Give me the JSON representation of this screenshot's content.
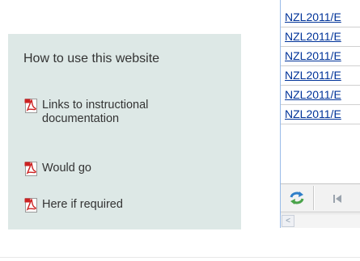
{
  "help": {
    "title": "How to use this website",
    "links": [
      {
        "label": "Links to instructional documentation",
        "icon": "pdf-icon"
      },
      {
        "label": "Would go",
        "icon": "pdf-icon"
      },
      {
        "label": "Here if required",
        "icon": "pdf-icon"
      }
    ]
  },
  "grid": {
    "rows": [
      {
        "id": "NZL2011/E"
      },
      {
        "id": "NZL2011/E"
      },
      {
        "id": "NZL2011/E"
      },
      {
        "id": "NZL2011/E"
      },
      {
        "id": "NZL2011/E"
      },
      {
        "id": "NZL2011/E"
      }
    ],
    "toolbar": {
      "refresh_icon": "refresh-icon",
      "first_page_icon": "first-page-icon"
    },
    "scroll_left_glyph": "<"
  },
  "colors": {
    "panel_bg": "#dde8e6",
    "link": "#003399",
    "pdf_red": "#cc2222"
  }
}
